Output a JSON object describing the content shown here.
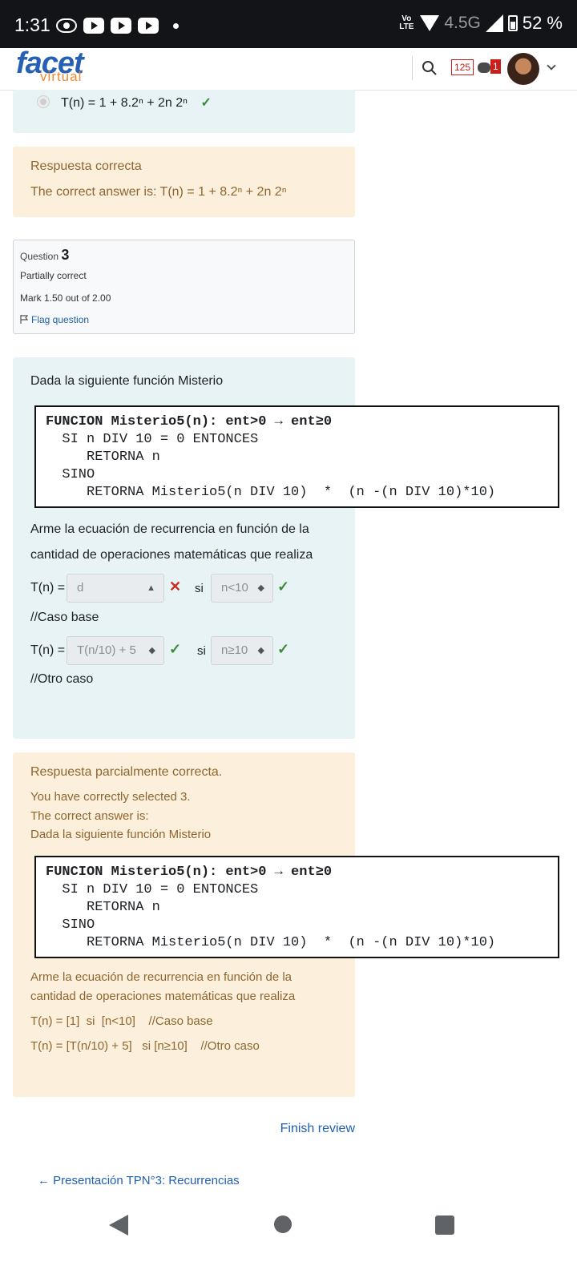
{
  "status_bar": {
    "time": "1:31",
    "volte": "Vo LTE",
    "network": "4.5G",
    "battery": "52 %"
  },
  "header": {
    "logo_main": "facet",
    "logo_sub": "virtual",
    "notifications_count": "125",
    "messages_count": "1"
  },
  "prev_question": {
    "option_text": "T(n) = 1  + 8.2ⁿ + 2n 2ⁿ",
    "mark": "✓"
  },
  "prev_feedback": {
    "status": "Respuesta correcta",
    "answer": "The correct answer is: T(n) = 1  + 8.2ⁿ + 2n 2ⁿ"
  },
  "question3": {
    "label": "Question",
    "number": "3",
    "state": "Partially correct",
    "mark": "Mark 1.50 out of 2.00",
    "flag": "Flag question",
    "intro": "Dada la siguiente función  Misterio",
    "code_lines": [
      "FUNCION Misterio5(n): ent>0 → ent≥0",
      "  SI n DIV 10 = 0 ENTONCES",
      "     RETORNA n",
      "  SINO",
      "     RETORNA Misterio5(n DIV 10)  *  (n -(n DIV 10)*10)"
    ],
    "instruction_line1": "Arme la ecuación de recurrencia en función de la",
    "instruction_line2": "cantidad de operaciones matemáticas que realiza",
    "row1": {
      "prefix": "T(n) =",
      "value": "d",
      "mark": "✕",
      "si": "si",
      "condition": "n<10",
      "cond_mark": "✓"
    },
    "note1": "//Caso base",
    "row2": {
      "prefix": "T(n) =",
      "value": "T(n/10) + 5",
      "mark": "✓",
      "si": "si",
      "condition": "n≥10",
      "cond_mark": "✓"
    },
    "note2": "//Otro caso"
  },
  "feedback3": {
    "status": "Respuesta parcialmente correcta.",
    "selected": "You have correctly selected 3.",
    "answer_intro": "The correct answer is:",
    "intro": "Dada la siguiente función  Misterio",
    "instruction_line1": "Arme la ecuación de recurrencia en función de la",
    "instruction_line2": "cantidad de operaciones matemáticas que realiza",
    "answer_line1": "T(n) = [1]  si  [n<10]    //Caso base",
    "answer_line2": "T(n) = [T(n/10) + 5]   si [n≥10]    //Otro caso"
  },
  "footer": {
    "finish_review": "Finish review",
    "prev_link": "← Presentación TPN°3: Recurrencias"
  }
}
